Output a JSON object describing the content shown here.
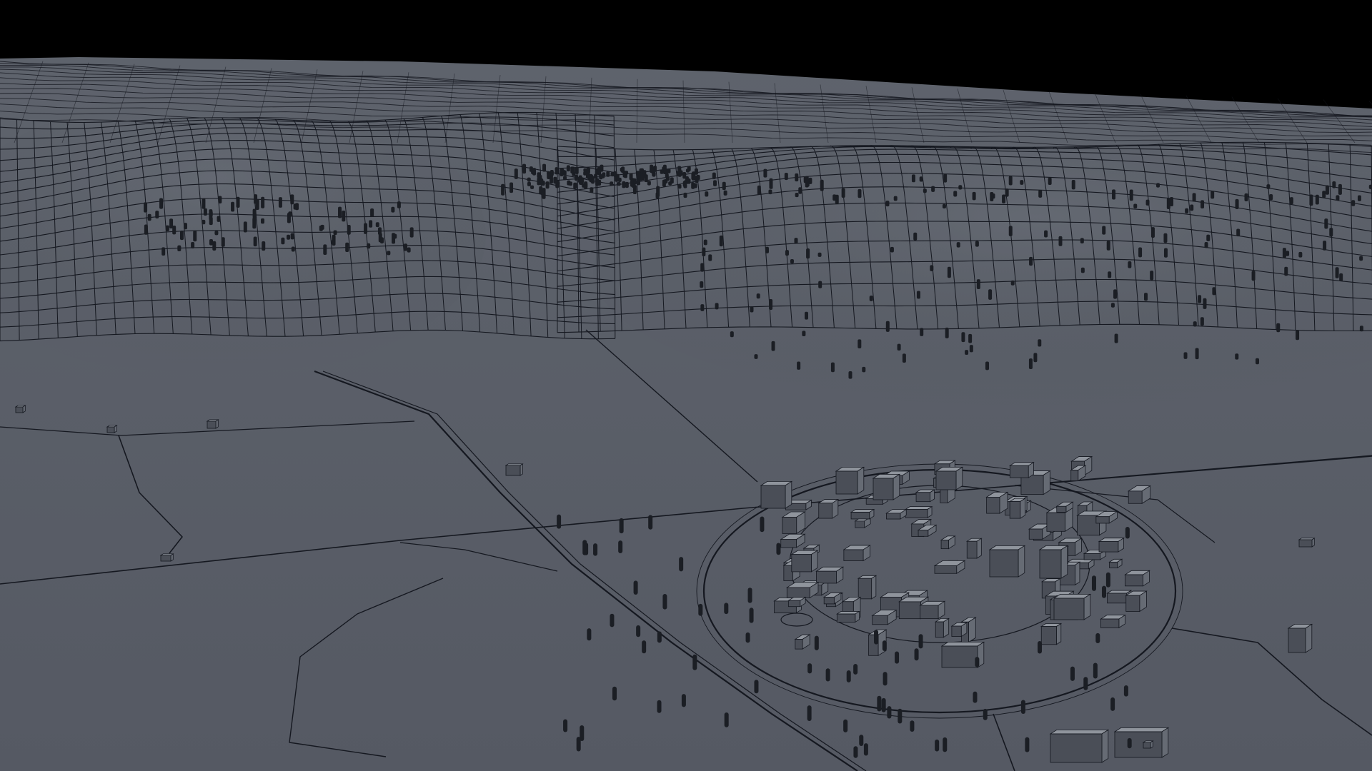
{
  "scene": {
    "subject": "wireframe-render-terrain-and-town",
    "colors": {
      "sky": "#000000",
      "ground_far": "#5e636c",
      "ground_near": "#555963",
      "line": "#151820",
      "building_top": "#8f949c",
      "building_side": "#666b74",
      "building_front": "#4a4e57",
      "tree": "#1b1e24"
    }
  }
}
